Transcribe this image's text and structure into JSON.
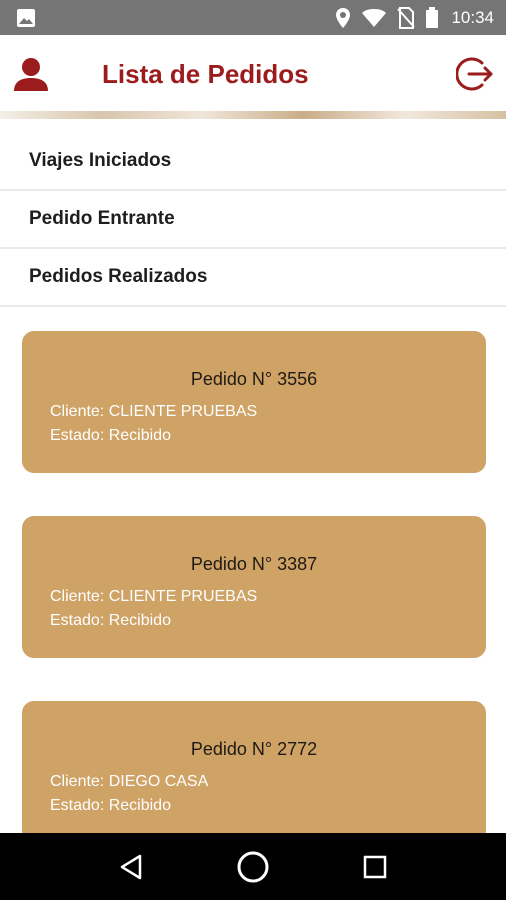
{
  "status_bar": {
    "time": "10:34",
    "icons": [
      "image-icon",
      "location-icon",
      "wifi-icon",
      "no-sim-icon",
      "battery-icon"
    ]
  },
  "app_bar": {
    "title": "Lista de Pedidos",
    "left_icon": "user-icon",
    "right_icon": "logout-icon"
  },
  "colors": {
    "accent": "#9b1c1c",
    "card": "#cfa265",
    "status_bar": "#757575"
  },
  "menu": {
    "items": [
      {
        "label": "Viajes Iniciados"
      },
      {
        "label": "Pedido Entrante"
      },
      {
        "label": "Pedidos Realizados"
      }
    ]
  },
  "orders": [
    {
      "title": "Pedido N° 3556",
      "cliente": "Cliente: CLIENTE PRUEBAS",
      "estado": "Estado: Recibido"
    },
    {
      "title": "Pedido N° 3387",
      "cliente": "Cliente: CLIENTE PRUEBAS",
      "estado": "Estado: Recibido"
    },
    {
      "title": "Pedido N° 2772",
      "cliente": "Cliente: DIEGO CASA",
      "estado": "Estado: Recibido"
    }
  ],
  "nav_bar": {
    "buttons": [
      "back-icon",
      "home-icon",
      "recents-icon"
    ]
  }
}
